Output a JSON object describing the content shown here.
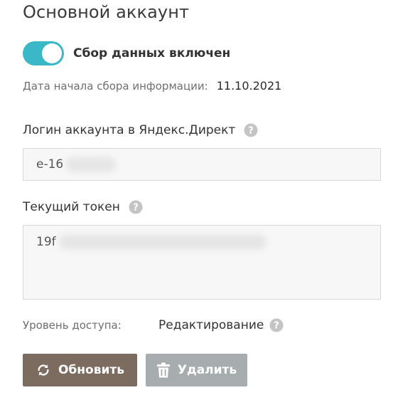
{
  "page": {
    "title": "Основной аккаунт"
  },
  "collection": {
    "enabled": true,
    "label": "Сбор данных включен",
    "start_label": "Дата начала сбора информации:",
    "start_date": "11.10.2021"
  },
  "login": {
    "label": "Логин аккаунта в Яндекс.Директ",
    "value": "e-16",
    "help_icon": "question-circle-icon"
  },
  "token": {
    "label": "Текущий токен",
    "value": "19f",
    "help_icon": "question-circle-icon"
  },
  "access": {
    "label": "Уровень доступа:",
    "value": "Редактирование",
    "help_icon": "question-circle-icon"
  },
  "buttons": {
    "refresh_label": "Обновить",
    "refresh_icon": "refresh-icon",
    "delete_label": "Удалить",
    "delete_icon": "trash-icon"
  },
  "colors": {
    "toggle_on": "#3bb8c8",
    "refresh_button": "#7c6b5f",
    "delete_button": "#a7acaf",
    "help_icon": "#c4c4c4"
  }
}
